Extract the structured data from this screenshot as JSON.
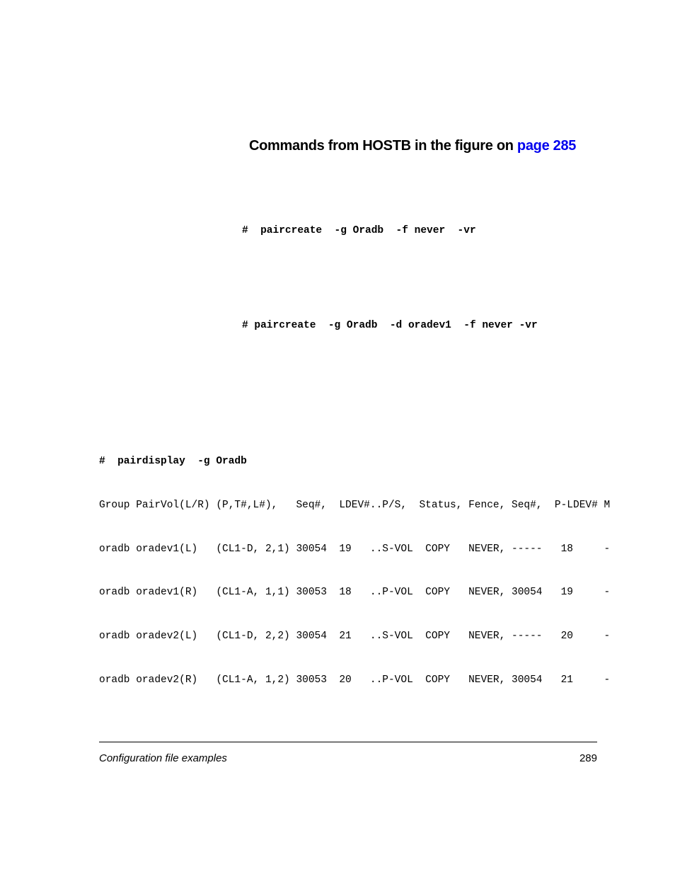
{
  "heading": {
    "prefix": "Commands from HOSTB in the figure on ",
    "link": "page 285"
  },
  "commands": {
    "cmd1": "#  paircreate  -g Oradb  -f never  -vr",
    "cmd2": "# paircreate  -g Oradb  -d oradev1  -f never -vr"
  },
  "pairdisplay": {
    "header": "#  pairdisplay  -g Oradb",
    "cols": "Group PairVol(L/R) (P,T#,L#),   Seq#,  LDEV#..P/S,  Status, Fence, Seq#,  P-LDEV# M",
    "rows": [
      "oradb oradev1(L)   (CL1-D, 2,1) 30054  19   ..S-VOL  COPY   NEVER, -----   18     -",
      "oradb oradev1(R)   (CL1-A, 1,1) 30053  18   ..P-VOL  COPY   NEVER, 30054   19     -",
      "oradb oradev2(L)   (CL1-D, 2,2) 30054  21   ..S-VOL  COPY   NEVER, -----   20     -",
      "oradb oradev2(R)   (CL1-A, 1,2) 30053  20   ..P-VOL  COPY   NEVER, 30054   21     -"
    ]
  },
  "footer": {
    "left": "Configuration file examples",
    "right": "289"
  }
}
